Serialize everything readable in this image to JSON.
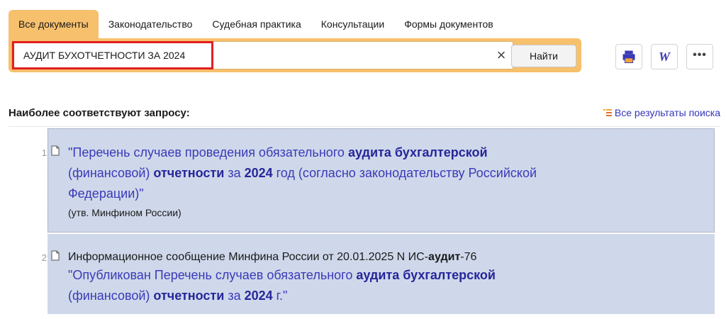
{
  "tabs": [
    {
      "label": "Все документы",
      "active": true
    },
    {
      "label": "Законодательство",
      "active": false
    },
    {
      "label": "Судебная практика",
      "active": false
    },
    {
      "label": "Консультации",
      "active": false
    },
    {
      "label": "Формы документов",
      "active": false
    }
  ],
  "search": {
    "query": "АУДИТ БУХОТЧЕТНОСТИ ЗА 2024",
    "clear_glyph": "×",
    "find_label": "Найти"
  },
  "tools": {
    "printer": "printer-icon",
    "word": "W",
    "more": "•••"
  },
  "results_header": {
    "title": "Наиболее соответствуют запросу:",
    "all_results_label": "Все результаты поиска"
  },
  "results": [
    {
      "number": "1",
      "line1": {
        "a": "\"Перечень случаев проведения обязательного ",
        "b": "аудита бухгалтерской"
      },
      "line2": {
        "a": "(финансовой) ",
        "b": "отчетности",
        "c": " за ",
        "d": "2024",
        "e": " год (согласно законодательству Российской"
      },
      "line3": "Федерации)\"",
      "note": "(утв. Минфином России)"
    },
    {
      "number": "2",
      "title": {
        "a": "Информационное сообщение Минфина России от 20.01.2025 N ИС-",
        "b": "аудит",
        "c": "-76"
      },
      "line1": {
        "a": "\"Опубликован Перечень случаев обязательного ",
        "b": "аудита бухгалтерской"
      },
      "line2": {
        "a": "(финансовой) ",
        "b": "отчетности",
        "c": " за ",
        "d": "2024",
        "e": " г.\""
      }
    }
  ],
  "colors": {
    "accent": "#f7c06c",
    "highlight_border": "#e02020",
    "result_bg": "#cfd8ea",
    "link": "#3a3ab8"
  }
}
